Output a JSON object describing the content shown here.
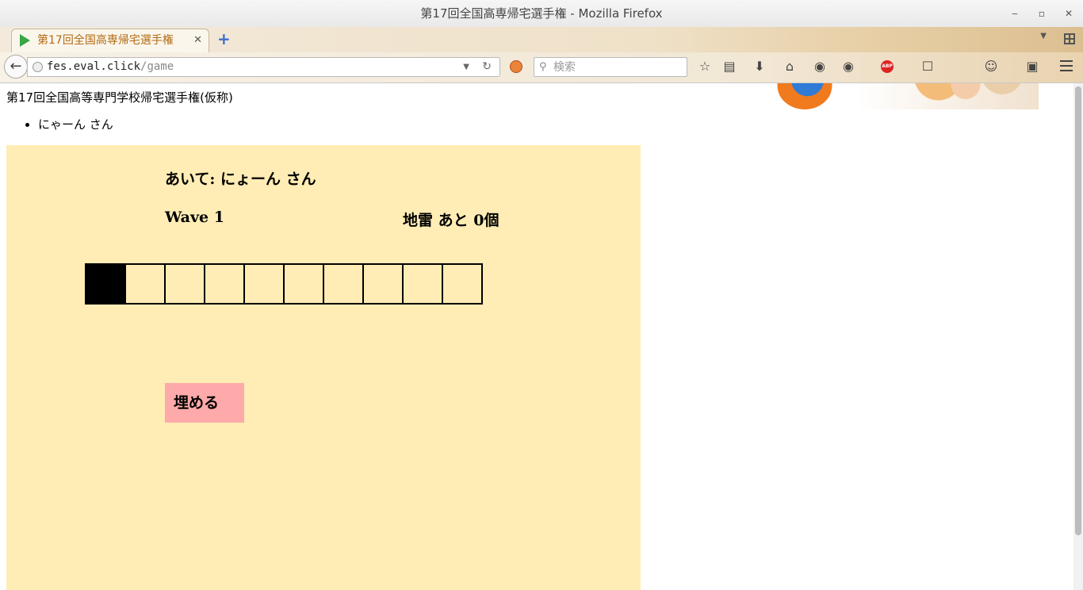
{
  "window": {
    "title": "第17回全国高専帰宅選手権 - Mozilla Firefox",
    "minimize": "‒",
    "maximize": "▫",
    "close": "✕"
  },
  "tabs": [
    {
      "label": "第17回全国高専帰宅選手権",
      "close": "✕",
      "active": true
    }
  ],
  "new_tab": "+",
  "url": {
    "host": "fes.eval.click",
    "path": "/game"
  },
  "search": {
    "placeholder": "検索"
  },
  "toolbar_icons": [
    "bookmark-star-icon",
    "reading-list-icon",
    "download-icon",
    "home-icon",
    "sync-icon",
    "addon-icon",
    "adblock-plus-icon",
    "lock-icon",
    "menu-icon"
  ],
  "abp_label": "ABP",
  "page": {
    "heading": "第17回全国高等専門学校帰宅選手権(仮称)",
    "players": [
      "にゃーん さん"
    ]
  },
  "game": {
    "opponent": "あいて: にょーん さん",
    "wave": "Wave 1",
    "mines_left": "地雷 あと 0個",
    "board": [
      true,
      false,
      false,
      false,
      false,
      false,
      false,
      false,
      false,
      false
    ],
    "bury_button": "埋める"
  },
  "colors": {
    "game_background": "#ffedb5",
    "button_background": "#ffaaaa",
    "tab_label": "#b16a12"
  }
}
